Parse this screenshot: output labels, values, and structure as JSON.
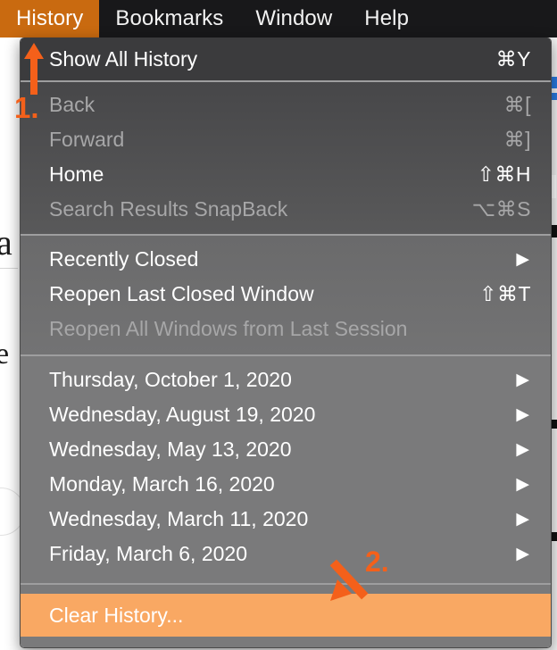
{
  "app": {
    "title": "Safari — History menu open",
    "accent_orange": "#c96a10",
    "highlight_orange": "#f9a863",
    "annotation_orange": "#f4601a",
    "menubar_bg": "#18181a"
  },
  "menubar": {
    "items": [
      {
        "label": "History",
        "active": true
      },
      {
        "label": "Bookmarks",
        "active": false
      },
      {
        "label": "Window",
        "active": false
      },
      {
        "label": "Help",
        "active": false
      }
    ]
  },
  "menu": {
    "sections": [
      {
        "name": "show-all-history",
        "items": [
          {
            "label": "Show All History",
            "shortcut": "⌘Y",
            "disabled": false,
            "submenu": false,
            "highlight": false
          }
        ]
      },
      {
        "name": "navigation",
        "items": [
          {
            "label": "Back",
            "shortcut": "⌘[",
            "disabled": true,
            "submenu": false,
            "highlight": false
          },
          {
            "label": "Forward",
            "shortcut": "⌘]",
            "disabled": true,
            "submenu": false,
            "highlight": false
          },
          {
            "label": "Home",
            "shortcut": "⇧⌘H",
            "disabled": false,
            "submenu": false,
            "highlight": false
          },
          {
            "label": "Search Results SnapBack",
            "shortcut": "⌥⌘S",
            "disabled": true,
            "submenu": false,
            "highlight": false
          }
        ]
      },
      {
        "name": "reopen",
        "items": [
          {
            "label": "Recently Closed",
            "shortcut": "",
            "disabled": false,
            "submenu": true,
            "highlight": false
          },
          {
            "label": "Reopen Last Closed Window",
            "shortcut": "⇧⌘T",
            "disabled": false,
            "submenu": false,
            "highlight": false
          },
          {
            "label": "Reopen All Windows from Last Session",
            "shortcut": "",
            "disabled": true,
            "submenu": false,
            "highlight": false
          }
        ]
      },
      {
        "name": "history-dates",
        "items": [
          {
            "label": "Thursday, October 1, 2020",
            "shortcut": "",
            "disabled": false,
            "submenu": true,
            "highlight": false
          },
          {
            "label": "Wednesday, August 19, 2020",
            "shortcut": "",
            "disabled": false,
            "submenu": true,
            "highlight": false
          },
          {
            "label": "Wednesday, May 13, 2020",
            "shortcut": "",
            "disabled": false,
            "submenu": true,
            "highlight": false
          },
          {
            "label": "Monday, March 16, 2020",
            "shortcut": "",
            "disabled": false,
            "submenu": true,
            "highlight": false
          },
          {
            "label": "Wednesday, March 11, 2020",
            "shortcut": "",
            "disabled": false,
            "submenu": true,
            "highlight": false
          },
          {
            "label": "Friday, March 6, 2020",
            "shortcut": "",
            "disabled": false,
            "submenu": true,
            "highlight": false
          }
        ]
      },
      {
        "name": "clear",
        "items": [
          {
            "label": "Clear History...",
            "shortcut": "",
            "disabled": false,
            "submenu": false,
            "highlight": true
          }
        ]
      }
    ],
    "submenu_glyph": "▶"
  },
  "annotations": [
    {
      "name": "step-1",
      "label": "1.",
      "arrow": "arrow-up",
      "target": "History menu title"
    },
    {
      "name": "step-2",
      "label": "2.",
      "arrow": "arrow-diagonal-down-left",
      "target": "Clear History..."
    }
  ],
  "background": {
    "left_glyphs": [
      "a",
      "e"
    ]
  }
}
